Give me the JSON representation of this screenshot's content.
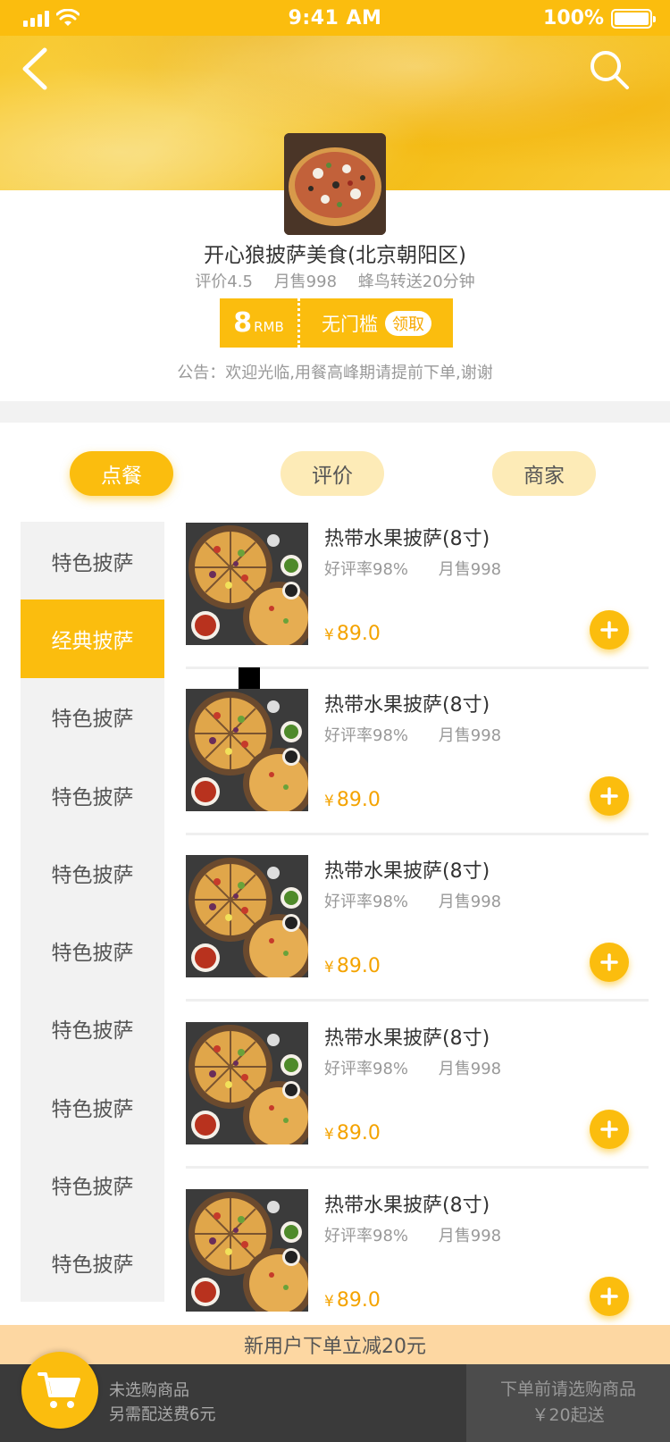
{
  "status_bar": {
    "time": "9:41 AM",
    "battery": "100%"
  },
  "store": {
    "name": "开心狼披萨美食(北京朝阳区)",
    "rating": "评价4.5",
    "monthly_sales": "月售998",
    "delivery": "蜂鸟转送20分钟",
    "notice": "公告：欢迎光临,用餐高峰期请提前下单,谢谢"
  },
  "coupon": {
    "amount": "8",
    "unit": "RMB",
    "condition": "无门槛",
    "claim_label": "领取"
  },
  "tabs": [
    {
      "label": "点餐",
      "active": true
    },
    {
      "label": "评价",
      "active": false
    },
    {
      "label": "商家",
      "active": false
    }
  ],
  "categories": [
    {
      "label": "特色披萨",
      "active": false
    },
    {
      "label": "经典披萨",
      "active": true
    },
    {
      "label": "特色披萨",
      "active": false
    },
    {
      "label": "特色披萨",
      "active": false
    },
    {
      "label": "特色披萨",
      "active": false
    },
    {
      "label": "特色披萨",
      "active": false
    },
    {
      "label": "特色披萨",
      "active": false
    },
    {
      "label": "特色披萨",
      "active": false
    },
    {
      "label": "特色披萨",
      "active": false
    },
    {
      "label": "特色披萨",
      "active": false
    }
  ],
  "products": [
    {
      "name": "热带水果披萨(8寸)",
      "rating": "好评率98%",
      "sales": "月售998",
      "currency": "¥",
      "price": "89.0"
    },
    {
      "name": "热带水果披萨(8寸)",
      "rating": "好评率98%",
      "sales": "月售998",
      "currency": "¥",
      "price": "89.0"
    },
    {
      "name": "热带水果披萨(8寸)",
      "rating": "好评率98%",
      "sales": "月售998",
      "currency": "¥",
      "price": "89.0"
    },
    {
      "name": "热带水果披萨(8寸)",
      "rating": "好评率98%",
      "sales": "月售998",
      "currency": "¥",
      "price": "89.0"
    },
    {
      "name": "热带水果披萨(8寸)",
      "rating": "好评率98%",
      "sales": "月售998",
      "currency": "¥",
      "price": "89.0"
    }
  ],
  "promo": "新用户下单立减20元",
  "cart": {
    "empty_label": "未选购商品",
    "delivery_fee": "另需配送费6元",
    "checkout_line1": "下单前请选购商品",
    "checkout_line2": "￥20起送"
  },
  "colors": {
    "accent": "#fbbd0e",
    "price": "#f4a300",
    "promo_bg": "#fdd7a2",
    "cart_bg": "#3a3a3a"
  },
  "icons": [
    "signal-icon",
    "wifi-icon",
    "battery-icon",
    "back-arrow-icon",
    "search-icon",
    "plus-icon",
    "cart-icon"
  ]
}
